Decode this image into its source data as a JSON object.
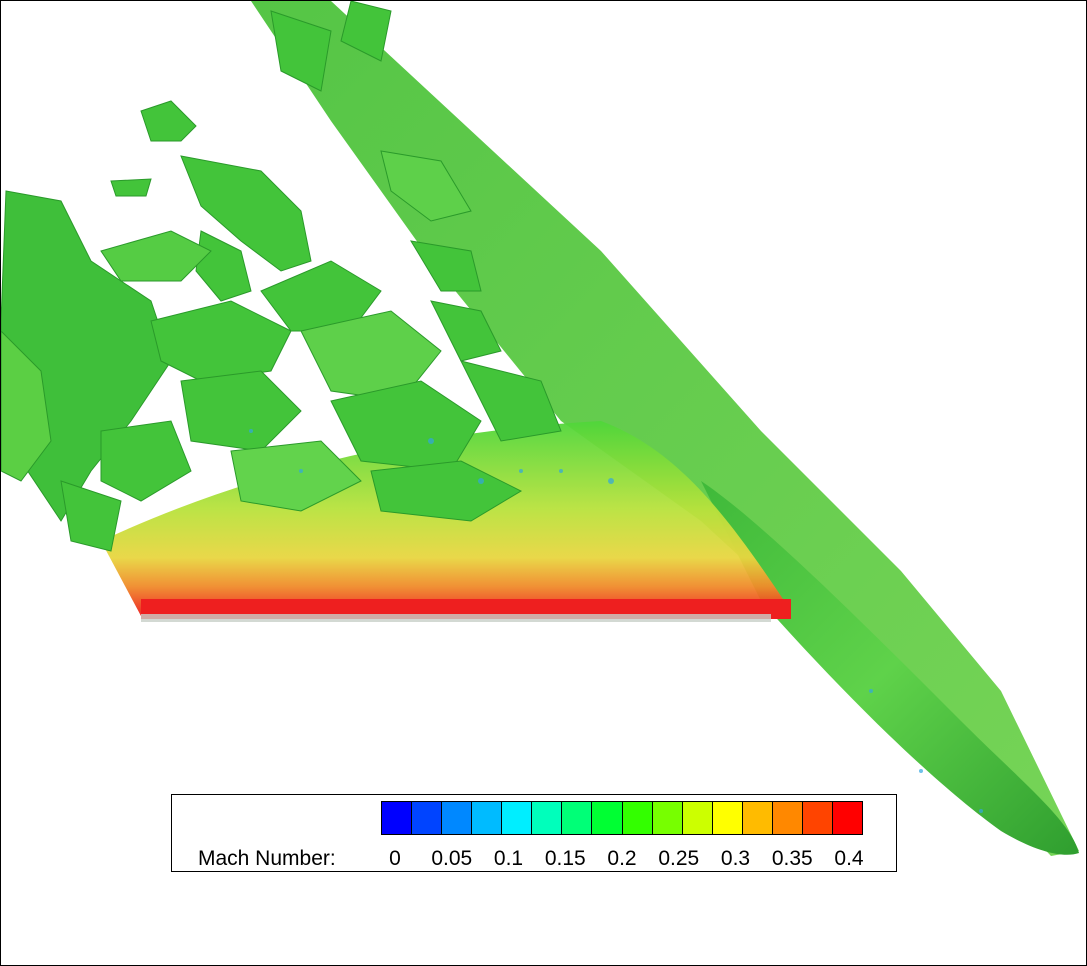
{
  "legend": {
    "label": "Mach Number:",
    "ticks": [
      "0",
      "0.05",
      "0.1",
      "0.15",
      "0.2",
      "0.25",
      "0.3",
      "0.35",
      "0.4"
    ],
    "colors": [
      "#0000ff",
      "#0044ff",
      "#0088ff",
      "#00bbff",
      "#00eeff",
      "#00ffbb",
      "#00ff77",
      "#00ff33",
      "#33ff00",
      "#77ff00",
      "#ccff00",
      "#ffff00",
      "#ffbb00",
      "#ff8800",
      "#ff4400",
      "#ff0000"
    ]
  },
  "colors": {
    "low": "#0000ff",
    "mid": "#22cc22",
    "high": "#ff0000"
  }
}
